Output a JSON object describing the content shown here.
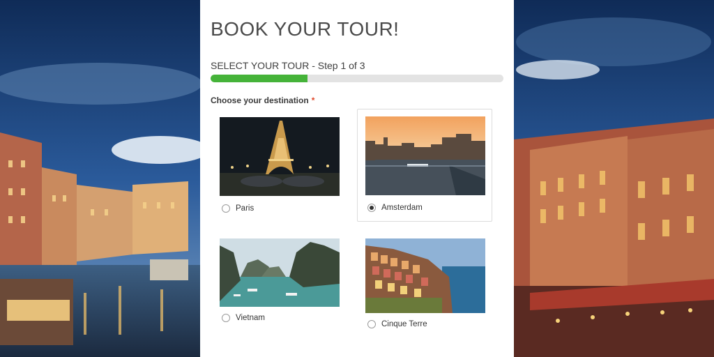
{
  "form": {
    "title": "BOOK YOUR TOUR!",
    "step_label": "SELECT YOUR TOUR - Step 1 of 3",
    "progress": 0.33,
    "field_label": "Choose your destination",
    "required_marker": "*"
  },
  "destinations": [
    {
      "label": "Paris",
      "selected": false,
      "image": "eiffel-tower-night"
    },
    {
      "label": "Amsterdam",
      "selected": true,
      "image": "amsterdam-canal-sunset"
    },
    {
      "label": "Vietnam",
      "selected": false,
      "image": "ha-long-bay"
    },
    {
      "label": "Cinque Terre",
      "selected": false,
      "image": "cinque-terre-cliffs"
    }
  ],
  "colors": {
    "accent": "#45b339",
    "required": "#e0482a",
    "progress_track": "#e3e3e3"
  }
}
